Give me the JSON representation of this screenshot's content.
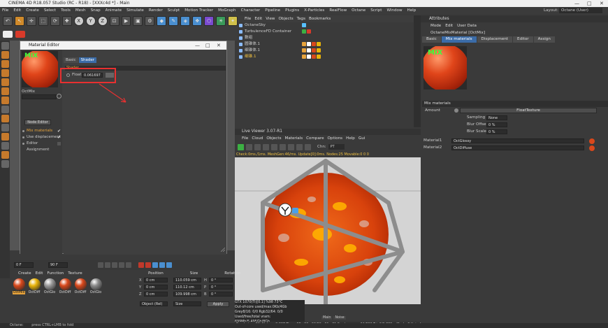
{
  "app": {
    "title": "CINEMA 4D R18.057 Studio (RC - R18) - [XXXc4d *] - Main",
    "menu": [
      "File",
      "Edit",
      "Create",
      "Select",
      "Tools",
      "Mesh",
      "Snap",
      "Animate",
      "Simulate",
      "Render",
      "Sculpt",
      "Motion Tracker",
      "MoGraph",
      "Character",
      "Pipeline",
      "Plugins",
      "X-Particles",
      "RealFlow",
      "Octane",
      "Script",
      "Window",
      "Help"
    ],
    "layout_label": "Layout:",
    "layout_value": "Octane (User)"
  },
  "material_editor": {
    "title": "Material Editor",
    "material_name": "OctMix",
    "preview_label": "MIX",
    "node_editor_button": "Node Editor",
    "channels": [
      {
        "label": "Mix materials",
        "active": true,
        "checked": true
      },
      {
        "label": "Use displacement",
        "active": false,
        "checked": true
      },
      {
        "label": "Editor",
        "active": false,
        "checked": false
      },
      {
        "label": "Assignment",
        "active": false,
        "checked": false
      }
    ],
    "tabs": [
      "Basic",
      "Shader"
    ],
    "active_tab": "Shader",
    "section": "Shader",
    "float_label": "Float",
    "float_value": "0.061697"
  },
  "object_manager": {
    "menu": [
      "File",
      "Edit",
      "View",
      "Objects",
      "Tags",
      "Bookmarks"
    ],
    "objects": [
      {
        "name": "OctaneSky"
      },
      {
        "name": "TurbulenceFD Container"
      },
      {
        "name": "数组"
      },
      {
        "name": "圆锥体.1"
      },
      {
        "name": "细锥体.1"
      },
      {
        "name": "细锥.1"
      }
    ]
  },
  "attributes": {
    "title": "Attributes",
    "menu": [
      "Mode",
      "Edit",
      "User Data"
    ],
    "object_name": "OctaneMixMaterial [OctMix]",
    "tabs": [
      "Basic",
      "Mix materials",
      "Displacement",
      "Editor",
      "Assign"
    ],
    "active_tab": "Mix materials",
    "section": "Mix materials",
    "amount_label": "Amount",
    "float_texture": "FloatTexture",
    "sampling_label": "Sampling",
    "sampling_value": "None",
    "blur_offset_label": "Blur Offset",
    "blur_offset_value": "0 %",
    "blur_scale_label": "Blur Scale",
    "blur_scale_value": "0 %",
    "material1_label": "Material1",
    "material1_value": "OctGlossy",
    "material2_label": "Material2",
    "material2_value": "OctDiffuse"
  },
  "live_viewer": {
    "title": "Live Viewer 3.07-R1",
    "menu": [
      "File",
      "Cloud",
      "Objects",
      "Materials",
      "Compare",
      "Options",
      "Help",
      "Gui"
    ],
    "channel_label": "Chn:",
    "channel_value": "PT",
    "status_line": "Check:0ms./1ms. MeshGen:46/ms. Update[0]:0ms. Nodes:25 Movable:0 0 0",
    "stats": [
      "GTX 1070(Ti)[0.1]       %98    73°C",
      "Out-of-core used/max:0Kb/4Gb",
      "Grey8/16: 0/0        Rgb32/64: 0/0",
      "Used/free/total vram: 699Mb/5.495Gb/8Gb"
    ],
    "bottom_tabs": [
      "Main",
      "Noise"
    ],
    "bottom_status": "Rendering: 8%  Ms/sec: 2.667   Time: 00 : 00 : 06/00 : 01 : 31   Spp/maxspp: 64/800   Tri: 0/2.833m  Mesh: 3   Hair: 0"
  },
  "timeline": {
    "frame_start": "0 F",
    "frame_end": "90 F"
  },
  "material_manager": {
    "menu": [
      "Create",
      "Edit",
      "Function",
      "Texture"
    ],
    "materials": [
      {
        "name": "OctMix",
        "color": "#d9481b",
        "selected": true
      },
      {
        "name": "OctDiff",
        "color": "#e8b30a",
        "selected": false
      },
      {
        "name": "OctGlo",
        "color": "#9a9a9a",
        "selected": false
      },
      {
        "name": "OctDiff",
        "color": "#d9481b",
        "selected": false
      },
      {
        "name": "OctDiff",
        "color": "#d9481b",
        "selected": false
      },
      {
        "name": "OctGlo",
        "color": "#8a8a8a",
        "selected": false
      }
    ]
  },
  "coordinates": {
    "headers": [
      "Position",
      "Size",
      "Rotation"
    ],
    "rows": [
      {
        "axis": "X",
        "pos": "0 cm",
        "size": "110.059 cm",
        "rot_axis": "H",
        "rot": "0 °"
      },
      {
        "axis": "Y",
        "pos": "0 cm",
        "size": "110.12 cm",
        "rot_axis": "P",
        "rot": "0 °"
      },
      {
        "axis": "Z",
        "pos": "0 cm",
        "size": "109.998 cm",
        "rot_axis": "B",
        "rot": "0 °"
      }
    ],
    "mode": "Object (Rel)",
    "size_mode": "Size",
    "apply": "Apply"
  },
  "statusbar": {
    "octane": "Octane:",
    "hint": "press CTRL+LMB to fold"
  },
  "colors": {
    "accent_orange": "#e8a43c",
    "highlight_red": "#e83030",
    "tab_blue": "#3b6ca8"
  }
}
